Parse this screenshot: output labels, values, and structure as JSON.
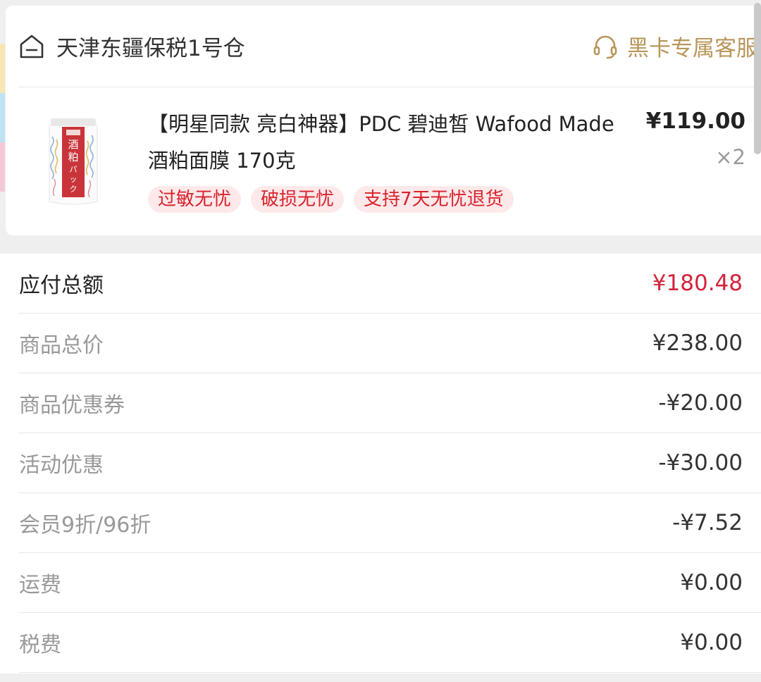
{
  "store": {
    "name": "天津东疆保税1号仓",
    "service_label": "黑卡专属客服"
  },
  "product": {
    "title": "【明星同款 亮白神器】PDC 碧迪皙 Wafood Made 酒粕面膜 170克",
    "price": "¥119.00",
    "quantity": "×2",
    "tags": [
      "过敏无忧",
      "破损无忧",
      "支持7天无忧退货"
    ],
    "image_text": "酒粕パック"
  },
  "summary": [
    {
      "label": "应付总额",
      "value": "¥180.48"
    },
    {
      "label": "商品总价",
      "value": "¥238.00"
    },
    {
      "label": "商品优惠券",
      "value": "-¥20.00"
    },
    {
      "label": "活动优惠",
      "value": "-¥30.00"
    },
    {
      "label": "会员9折/96折",
      "value": "-¥7.52"
    },
    {
      "label": "运费",
      "value": "¥0.00"
    },
    {
      "label": "税费",
      "value": "¥0.00"
    }
  ],
  "colors": {
    "accent_gold": "#b89659",
    "total_red": "#d4233b",
    "tag_red": "#d9232d",
    "tag_bg": "#fde9ea"
  }
}
